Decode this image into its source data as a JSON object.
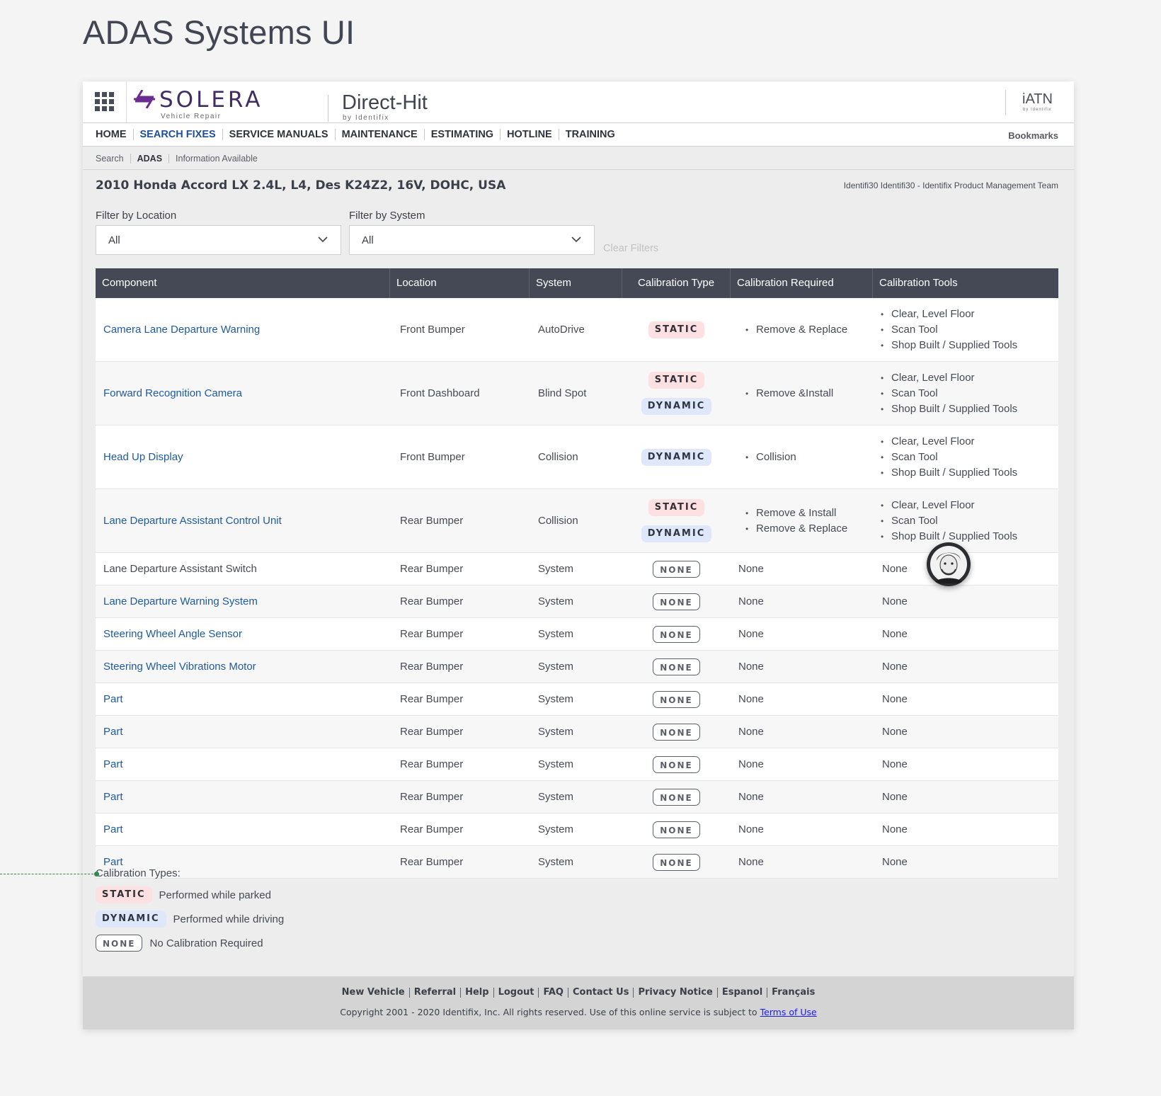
{
  "page_title": "ADAS Systems UI",
  "brand": {
    "name": "SOLERA",
    "sub": "Vehicle Repair",
    "product": "Direct-Hit",
    "product_sub": "by Identifix",
    "partner": "iATN",
    "partner_sub": "by Identifix",
    "accent": "#3f2e63"
  },
  "nav": {
    "items": [
      "HOME",
      "SEARCH FIXES",
      "SERVICE MANUALS",
      "MAINTENANCE",
      "ESTIMATING",
      "HOTLINE",
      "TRAINING"
    ],
    "active": "SEARCH FIXES",
    "bookmarks": "Bookmarks"
  },
  "breadcrumb": [
    "Search",
    "ADAS",
    "Information Available"
  ],
  "vehicle": "2010 Honda Accord LX 2.4L, L4, Des K24Z2, 16V, DOHC, USA",
  "user": "Identifi30 Identifi30 - Identifix Product Management Team",
  "filters": {
    "location_label": "Filter by Location",
    "location_value": "All",
    "system_label": "Filter by System",
    "system_value": "All",
    "clear": "Clear Filters"
  },
  "table": {
    "headers": [
      "Component",
      "Location",
      "System",
      "Calibration Type",
      "Calibration Required",
      "Calibration Tools"
    ]
  },
  "legend": {
    "title": "Calibration Types:",
    "static_label": "STATIC",
    "static_desc": "Performed while parked",
    "dynamic_label": "DYNAMIC",
    "dynamic_desc": "Performed while driving",
    "none_label": "NONE",
    "none_desc": "No Calibration Required"
  },
  "footer": {
    "links": [
      "New Vehicle",
      "Referral",
      "Help",
      "Logout",
      "FAQ",
      "Contact Us",
      "Privacy Notice",
      "Espanol",
      "Français"
    ],
    "copyright": "Copyright 2001 - 2020 Identifix, Inc. All rights reserved. Use of this online service is subject to",
    "terms": "Terms of Use"
  },
  "colors": {
    "header_bg": "#444955",
    "link": "#1f5a9c",
    "static_bg": "#fde0e2",
    "dynamic_bg": "#dfe8fa"
  }
}
